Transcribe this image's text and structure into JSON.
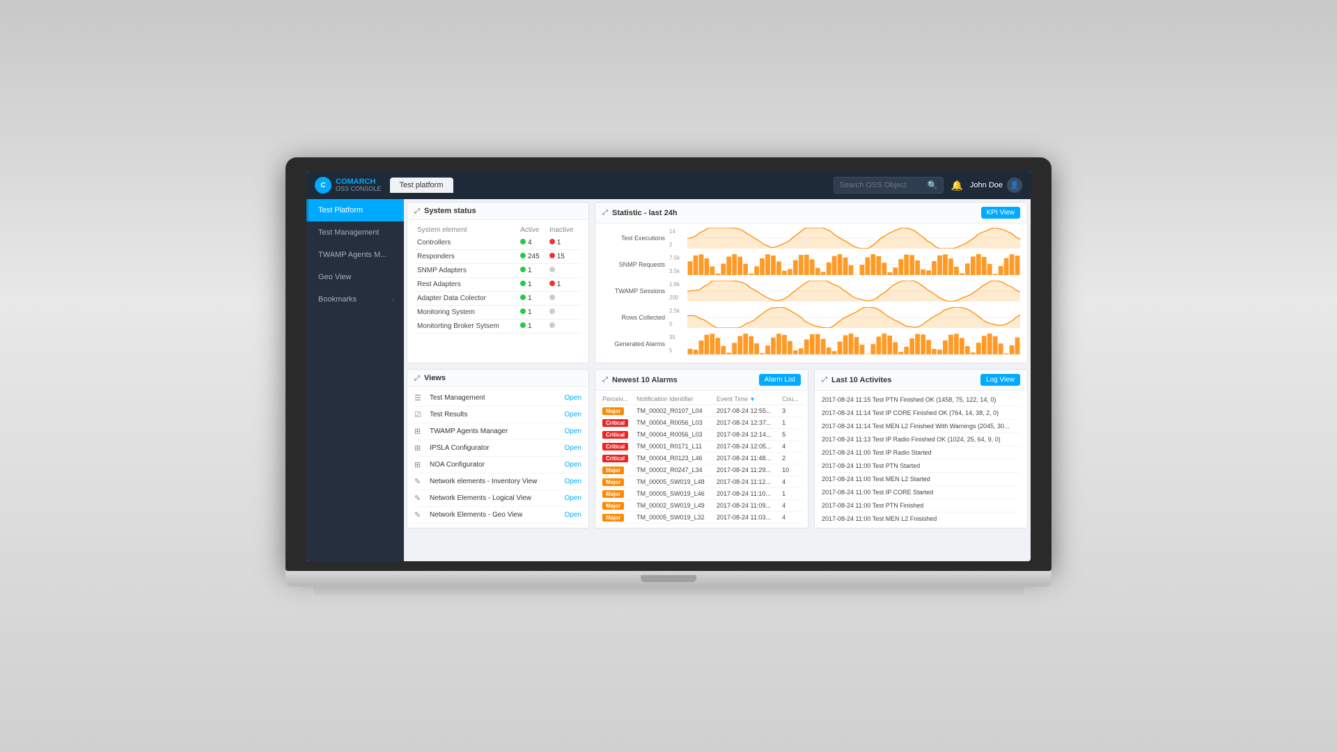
{
  "topbar": {
    "brand": "COMARCH",
    "sub_label": "OSS CONSOLE",
    "tab_label": "Test platform",
    "search_placeholder": "Search OSS Object",
    "bell_label": "🔔",
    "user_name": "John Doe",
    "user_icon": "👤"
  },
  "sidebar": {
    "items": [
      {
        "id": "test-platform",
        "label": "Test Platform",
        "active": true,
        "has_chevron": false
      },
      {
        "id": "test-management",
        "label": "Test Management",
        "active": false,
        "has_chevron": false
      },
      {
        "id": "twamp-agents",
        "label": "TWAMP Agents M...",
        "active": false,
        "has_chevron": false
      },
      {
        "id": "geo-view",
        "label": "Geo View",
        "active": false,
        "has_chevron": false
      },
      {
        "id": "bookmarks",
        "label": "Bookmarks",
        "active": false,
        "has_chevron": true
      }
    ]
  },
  "system_status": {
    "title": "System status",
    "headers": [
      "System element",
      "Active",
      "Inactive"
    ],
    "rows": [
      {
        "name": "Controllers",
        "active_color": "green",
        "active_val": "4",
        "inactive_color": "red",
        "inactive_val": "1"
      },
      {
        "name": "Responders",
        "active_color": "green",
        "active_val": "245",
        "inactive_color": "red",
        "inactive_val": "15"
      },
      {
        "name": "SNMP Adapters",
        "active_color": "green",
        "active_val": "1",
        "inactive_color": "gray",
        "inactive_val": ""
      },
      {
        "name": "Rest Adapters",
        "active_color": "green",
        "active_val": "1",
        "inactive_color": "red",
        "inactive_val": "1"
      },
      {
        "name": "Adapter Data Colector",
        "active_color": "green",
        "active_val": "1",
        "inactive_color": "gray",
        "inactive_val": ""
      },
      {
        "name": "Monitoring System",
        "active_color": "green",
        "active_val": "1",
        "inactive_color": "gray",
        "inactive_val": ""
      },
      {
        "name": "Monitorting Broker Sytsem",
        "active_color": "green",
        "active_val": "1",
        "inactive_color": "gray",
        "inactive_val": ""
      }
    ]
  },
  "statistics": {
    "title": "Statistic - last 24h",
    "kpi_button": "KPI View",
    "charts": [
      {
        "label": "Test Executions",
        "y_max": "14",
        "y_mid": "2",
        "color": "#ff8800"
      },
      {
        "label": "SNMP Requests",
        "y_max": "7.5k",
        "y_mid": "3.5k",
        "color": "#ff8800"
      },
      {
        "label": "TWAMP Sessions",
        "y_max": "1.6k",
        "y_mid": "200",
        "color": "#ff8800"
      },
      {
        "label": "Rows Collected",
        "y_max": "2.5k",
        "y_mid": "0",
        "color": "#ff8800"
      },
      {
        "label": "Generated Alarms",
        "y_max": "35",
        "y_mid": "5",
        "color": "#ff8800"
      }
    ]
  },
  "views": {
    "title": "Views",
    "items": [
      {
        "icon": "☰",
        "name": "Test Management",
        "open": "Open"
      },
      {
        "icon": "☑",
        "name": "Test Results",
        "open": "Open"
      },
      {
        "icon": "⊞",
        "name": "TWAMP Agents Manager",
        "open": "Open"
      },
      {
        "icon": "⊞",
        "name": "IPSLA Configurator",
        "open": "Open"
      },
      {
        "icon": "⊞",
        "name": "NOA Configurator",
        "open": "Open"
      },
      {
        "icon": "✎",
        "name": "Network elements - Inventory View",
        "open": "Open"
      },
      {
        "icon": "✎",
        "name": "Network Elements - Logical View",
        "open": "Open"
      },
      {
        "icon": "✎",
        "name": "Network Elements - Geo View",
        "open": "Open"
      }
    ]
  },
  "alarms": {
    "title": "Newest 10 Alarms",
    "alarm_btn": "Alarm List",
    "headers": [
      "Perceiv...",
      "Notification Identifier",
      "Event Time",
      "Cou..."
    ],
    "rows": [
      {
        "severity": "Major",
        "sev_class": "sev-major",
        "notification": "TM_00002_R0107_L04",
        "event_time": "2017-08-24 12:55...",
        "count": "3"
      },
      {
        "severity": "Critical",
        "sev_class": "sev-critical",
        "notification": "TM_00004_R0056_L03",
        "event_time": "2017-08-24 12:37...",
        "count": "1"
      },
      {
        "severity": "Critical",
        "sev_class": "sev-critical",
        "notification": "TM_00004_R0056_L03",
        "event_time": "2017-08-24 12:14...",
        "count": "5"
      },
      {
        "severity": "Critical",
        "sev_class": "sev-critical",
        "notification": "TM_00001_R0171_L11",
        "event_time": "2017-08-24 12:05...",
        "count": "4"
      },
      {
        "severity": "Critical",
        "sev_class": "sev-critical",
        "notification": "TM_00004_R0123_L46",
        "event_time": "2017-08-24 11:48...",
        "count": "2"
      },
      {
        "severity": "Major",
        "sev_class": "sev-major",
        "notification": "TM_00002_R0247_L34",
        "event_time": "2017-08-24 11:29...",
        "count": "10"
      },
      {
        "severity": "Major",
        "sev_class": "sev-major",
        "notification": "TM_00005_SW019_L48",
        "event_time": "2017-08-24 11:12...",
        "count": "4"
      },
      {
        "severity": "Major",
        "sev_class": "sev-major",
        "notification": "TM_00005_SW019_L46",
        "event_time": "2017-08-24 11:10...",
        "count": "1"
      },
      {
        "severity": "Major",
        "sev_class": "sev-major",
        "notification": "TM_00002_SW019_L49",
        "event_time": "2017-08-24 11:09...",
        "count": "4"
      },
      {
        "severity": "Major",
        "sev_class": "sev-major",
        "notification": "TM_00005_SW019_L32",
        "event_time": "2017-08-24 11:03...",
        "count": "4"
      }
    ]
  },
  "activities": {
    "title": "Last 10 Activites",
    "log_btn": "Log View",
    "items": [
      "2017-08-24 11:15 Test PTN Finished OK (1458, 75, 122, 14, 0)",
      "2017-08-24 11:14 Test IP CORE Finished OK (764, 14, 38, 2, 0)",
      "2017-08-24 11:14 Test MEN L2 Finished With Warnings (2045, 30...",
      "2017-08-24 11:13 Test IP Radio Finished OK (1024, 25, 64, 9, 0)",
      "2017-08-24 11:00 Test IP Radio Started",
      "2017-08-24 11:00 Test PTN Started",
      "2017-08-24 11:00 Test MEN L2 Started",
      "2017-08-24 11:00 Test IP CORE Started",
      "2017-08-24 11:00 Test PTN Finished",
      "2017-08-24 11:00 Test MEN L2 Fnisished"
    ]
  }
}
